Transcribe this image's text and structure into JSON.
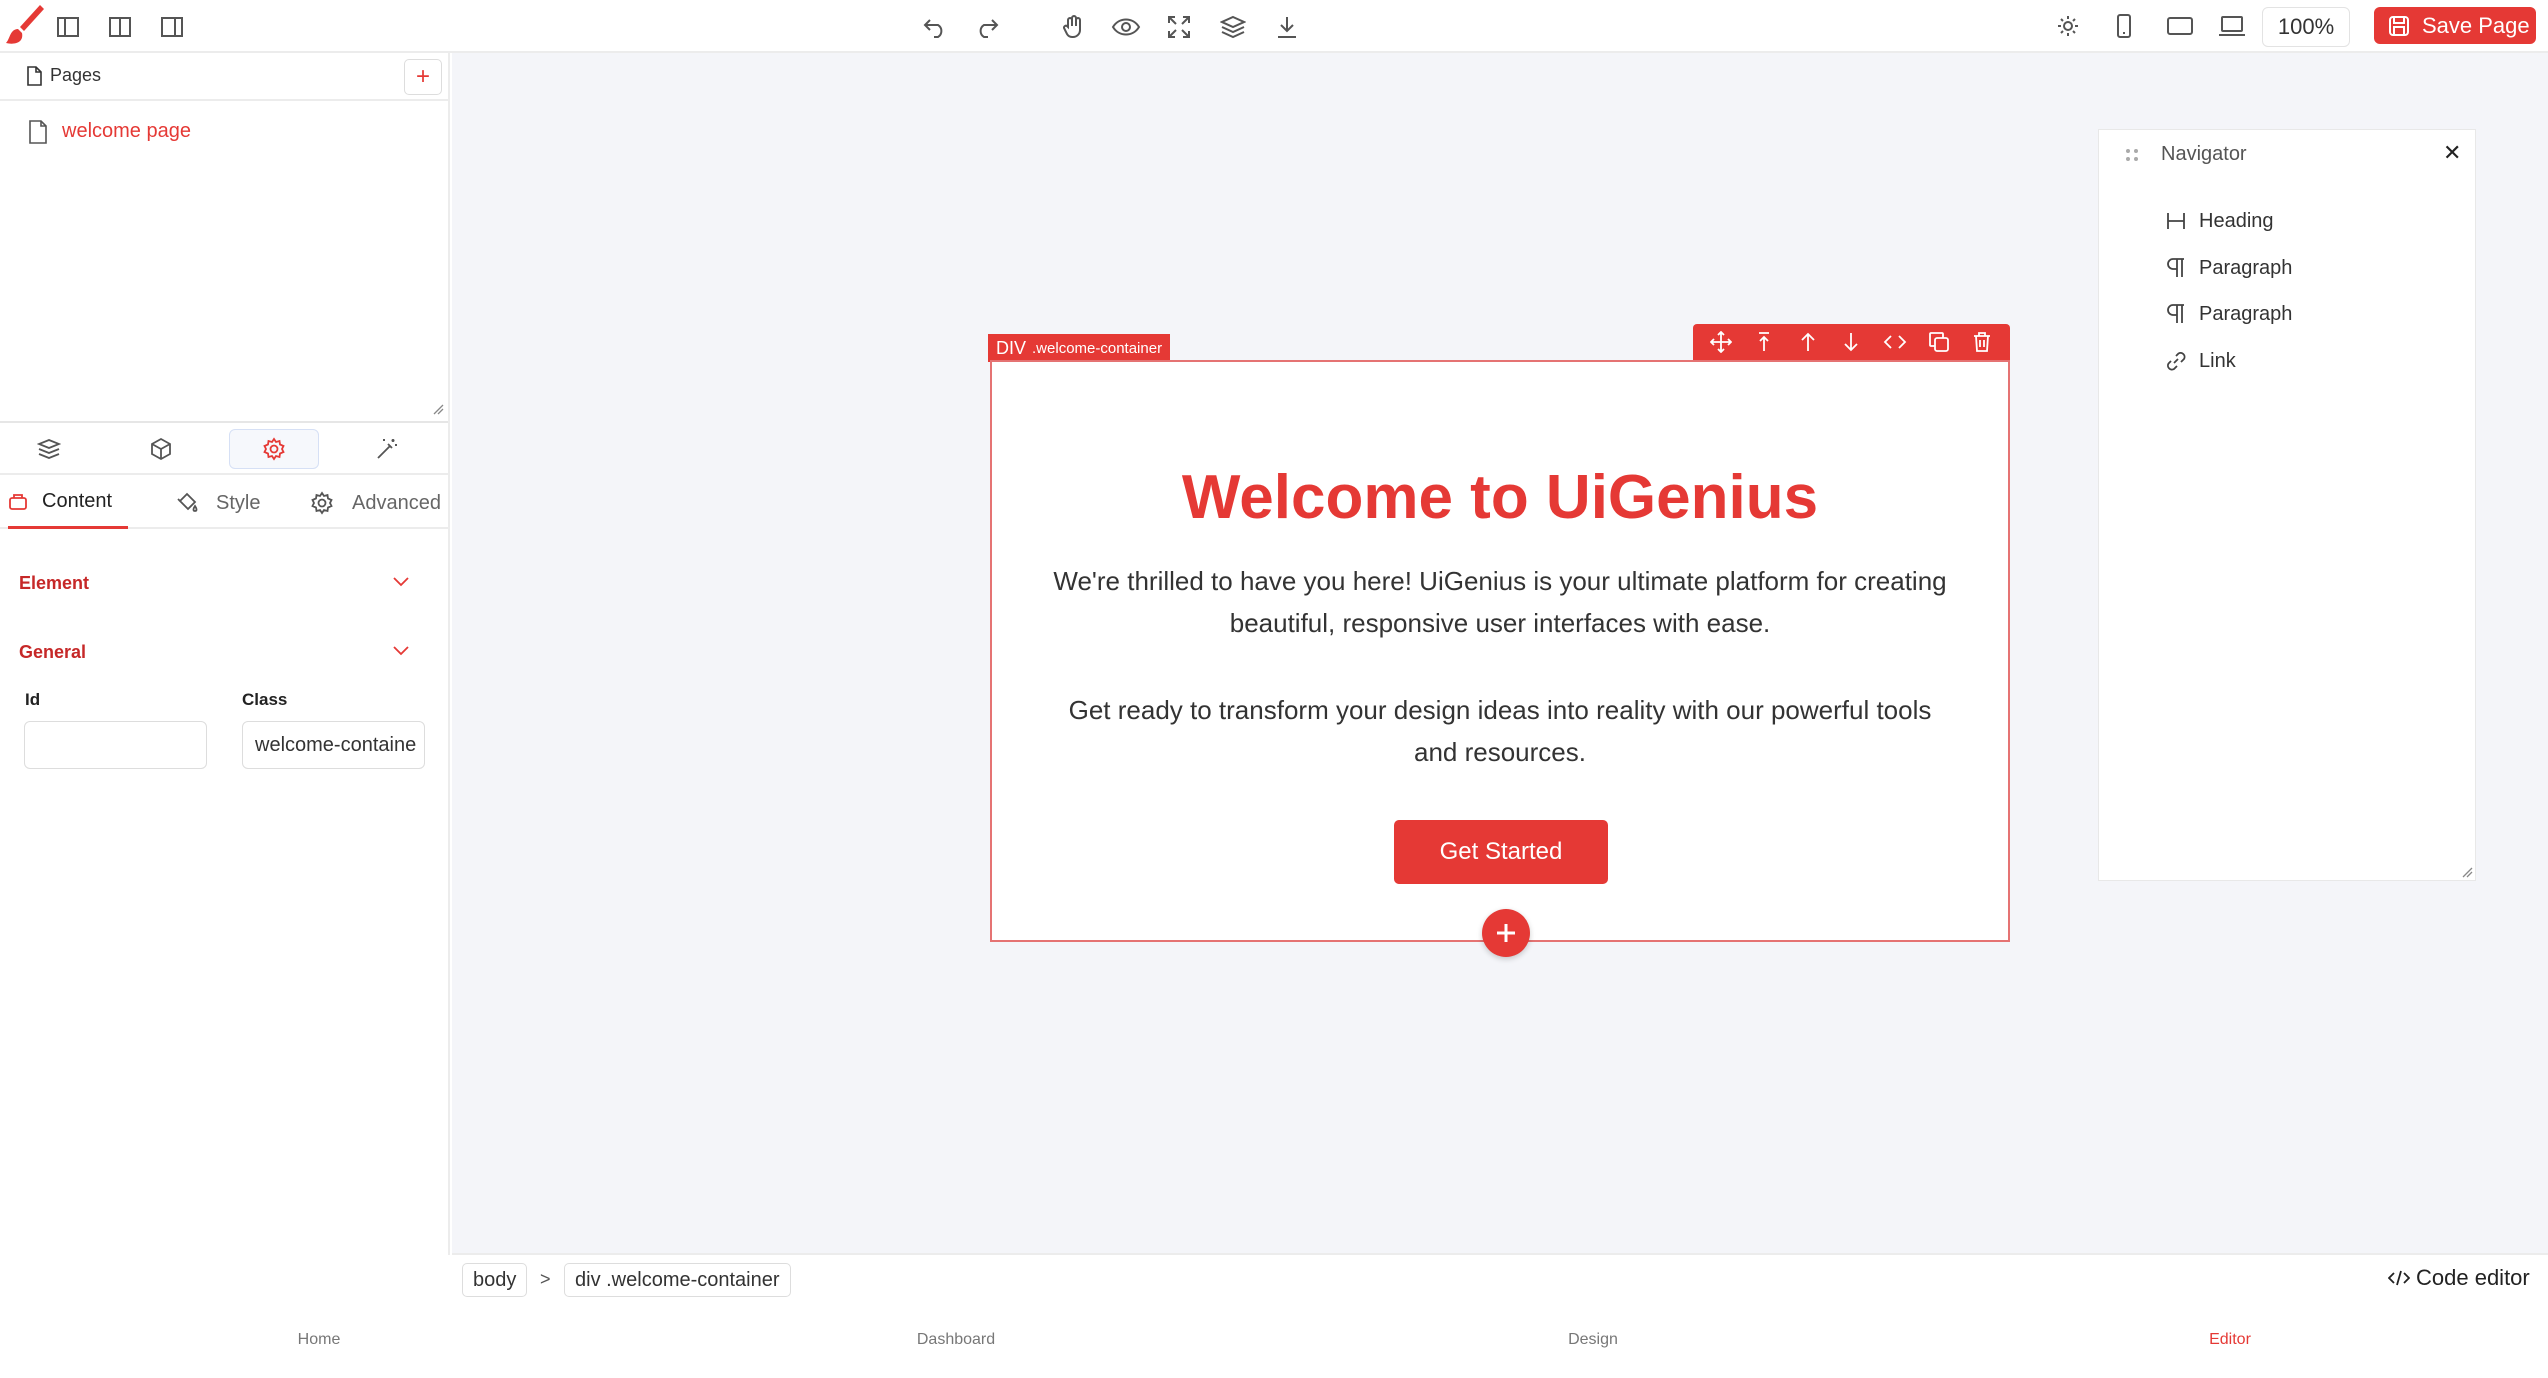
{
  "toolbar": {
    "zoom": "100%",
    "save_label": "Save Page",
    "icons": [
      "brush-logo-icon",
      "layout-left-icon",
      "layout-center-icon",
      "layout-right-icon",
      "undo-icon",
      "redo-icon",
      "hand-icon",
      "eye-icon",
      "fullscreen-icon",
      "layers-icon",
      "download-icon",
      "sun-icon",
      "mobile-icon",
      "tablet-icon",
      "laptop-icon"
    ]
  },
  "sidebar": {
    "pages_title": "Pages",
    "add_page": "+",
    "pages": [
      {
        "label": "welcome page"
      }
    ],
    "panel_tabs": [
      {
        "label": "Content",
        "icon": "box-icon"
      },
      {
        "label": "Style",
        "icon": "paint-bucket-icon"
      },
      {
        "label": "Advanced",
        "icon": "gear-icon"
      }
    ],
    "sections": {
      "element": "Element",
      "general": "General"
    },
    "fields": {
      "id_label": "Id",
      "id_value": "",
      "class_label": "Class",
      "class_value": "welcome-containe"
    }
  },
  "canvas": {
    "tag": "DIV",
    "tag_class": ".welcome-container",
    "heading": "Welcome to UiGenius",
    "para1": "We're thrilled to have you here! UiGenius is your ultimate platform for creating beautiful, responsive user interfaces with ease.",
    "para2": "Get ready to transform your design ideas into reality with our powerful tools and resources.",
    "button": "Get Started"
  },
  "navigator": {
    "title": "Navigator",
    "close": "✕",
    "items": [
      {
        "label": "Heading",
        "icon": "heading-icon"
      },
      {
        "label": "Paragraph",
        "icon": "paragraph-icon"
      },
      {
        "label": "Paragraph",
        "icon": "paragraph-icon"
      },
      {
        "label": "Link",
        "icon": "link-icon"
      }
    ]
  },
  "breadcrumb": {
    "items": [
      "body",
      "div .welcome-container"
    ],
    "separator": ">"
  },
  "code_editor": "Code editor",
  "bottom_nav": [
    "Home",
    "Dashboard",
    "Design",
    "Editor"
  ],
  "colors": {
    "accent": "#e53935",
    "canvas_bg": "#f4f5f9"
  }
}
